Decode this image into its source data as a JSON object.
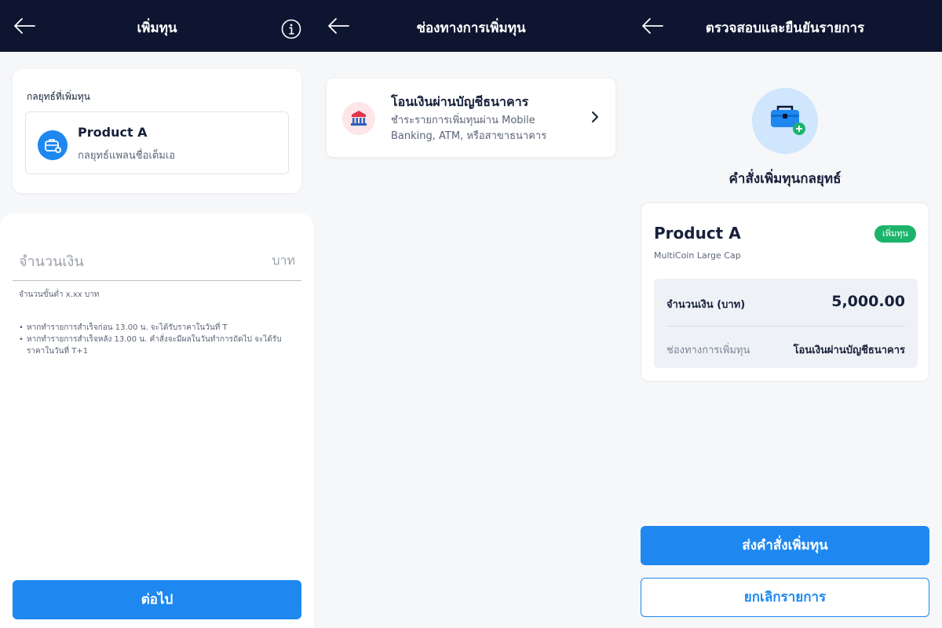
{
  "screen1": {
    "title": "เพิ่มทุน",
    "strategy_label": "กลยุทธ์ที่เพิ่มทุน",
    "product_name": "Product A",
    "product_sub": "กลยุทธ์แพลนชื่อเต็มเอ",
    "amount_placeholder": "จำนวนเงิน",
    "amount_unit": "บาท",
    "min_note": "จำนวนขั้นต่ำ x.xx บาท",
    "notes": [
      "หากทำรายการสำเร็จก่อน 13.00 น. จะได้รับราคาในวันที่ T",
      "หากทำรายการสำเร็จหลัง 13.00 น. คำสั่งจะมีผลในวันทำการถัดไป จะได้รับราคาในวันที่ T+1"
    ],
    "next_label": "ต่อไป"
  },
  "screen2": {
    "title": "ช่องทางการเพิ่มทุน",
    "channel_title": "โอนเงินผ่านบัญชีธนาคาร",
    "channel_desc": "ชำระรายการเพิ่มทุนผ่าน Mobile Banking, ATM, หรือสาขาธนาคาร"
  },
  "screen3": {
    "title": "ตรวจสอบและยืนยันรายการ",
    "order_title": "คำสั่งเพิ่มทุนกลยุทธ์",
    "product_name": "Product A",
    "product_sub": "MultiCoin Large Cap",
    "badge": "เพิ่มทุน",
    "amount_label": "จำนวนเงิน (บาท)",
    "amount_value": "5,000.00",
    "channel_label": "ช่องทางการเพิ่มทุน",
    "channel_value": "โอนเงินผ่านบัญชีธนาคาร",
    "submit_label": "ส่งคำสั่งเพิ่มทุน",
    "cancel_label": "ยกเลิกรายการ"
  },
  "icons": {
    "back": "arrow-left-icon",
    "info": "info-icon",
    "strategy": "briefcase-icon",
    "bank": "bank-icon",
    "chevron": "chevron-right-icon",
    "hero": "toolbox-plus-icon"
  },
  "colors": {
    "header": "#0d1530",
    "primary": "#1e88f0",
    "badge": "#1cb36b",
    "background": "#f6f7f9"
  }
}
